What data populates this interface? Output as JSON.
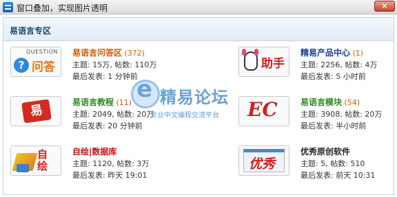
{
  "window": {
    "title": "窗口叠加，实现图片透明",
    "close_glyph": "✕",
    "app_icon": "app-logo-icon"
  },
  "panel": {
    "title": "易语言专区"
  },
  "watermark": {
    "name": "精易论坛",
    "slogan": "专业中文编程交流平台"
  },
  "forums": [
    {
      "name": "易语言问答区",
      "count": "(372)",
      "stats": "主题: 15万, 帖数: 110万",
      "last_post": "最后发表: 1 分钟前",
      "icon": "qa-icon",
      "icon_top": "QUESTION",
      "icon_text": "问答",
      "color": "#d35a00"
    },
    {
      "name": "精易产品中心",
      "count": "(1)",
      "stats": "主题: 2256, 帖数: 4万",
      "last_post": "最后发表: 5 小时前",
      "icon": "assistant-icon",
      "icon_text": "助手",
      "color": "#1a3f96"
    },
    {
      "name": "易语言教程",
      "count": "(11)",
      "stats": "主题: 2049, 帖数: 20万",
      "last_post": "最后发表: 20 分钟前",
      "icon": "tutorial-icon",
      "icon_text": "易",
      "color": "#2e8a1e"
    },
    {
      "name": "易语言模块",
      "count": "(54)",
      "stats": "主题: 3908, 帖数: 20万",
      "last_post": "最后发表: 半小时前",
      "icon": "module-icon",
      "icon_text": "EC",
      "color": "#2e8a1e"
    },
    {
      "name": "自绘|数据库",
      "count": "",
      "stats": "主题: 1120, 帖数: 3万",
      "last_post": "最后发表: 昨天 19:01",
      "icon": "self-draw-icon",
      "icon_text": "自绘",
      "color": "#cc1111"
    },
    {
      "name": "优秀原创软件",
      "count": "",
      "stats": "主题: 5, 帖数: 510",
      "last_post": "最后发表: 前天 10:31",
      "icon": "original-software-icon",
      "icon_text": "优秀",
      "color": "#222222"
    }
  ]
}
